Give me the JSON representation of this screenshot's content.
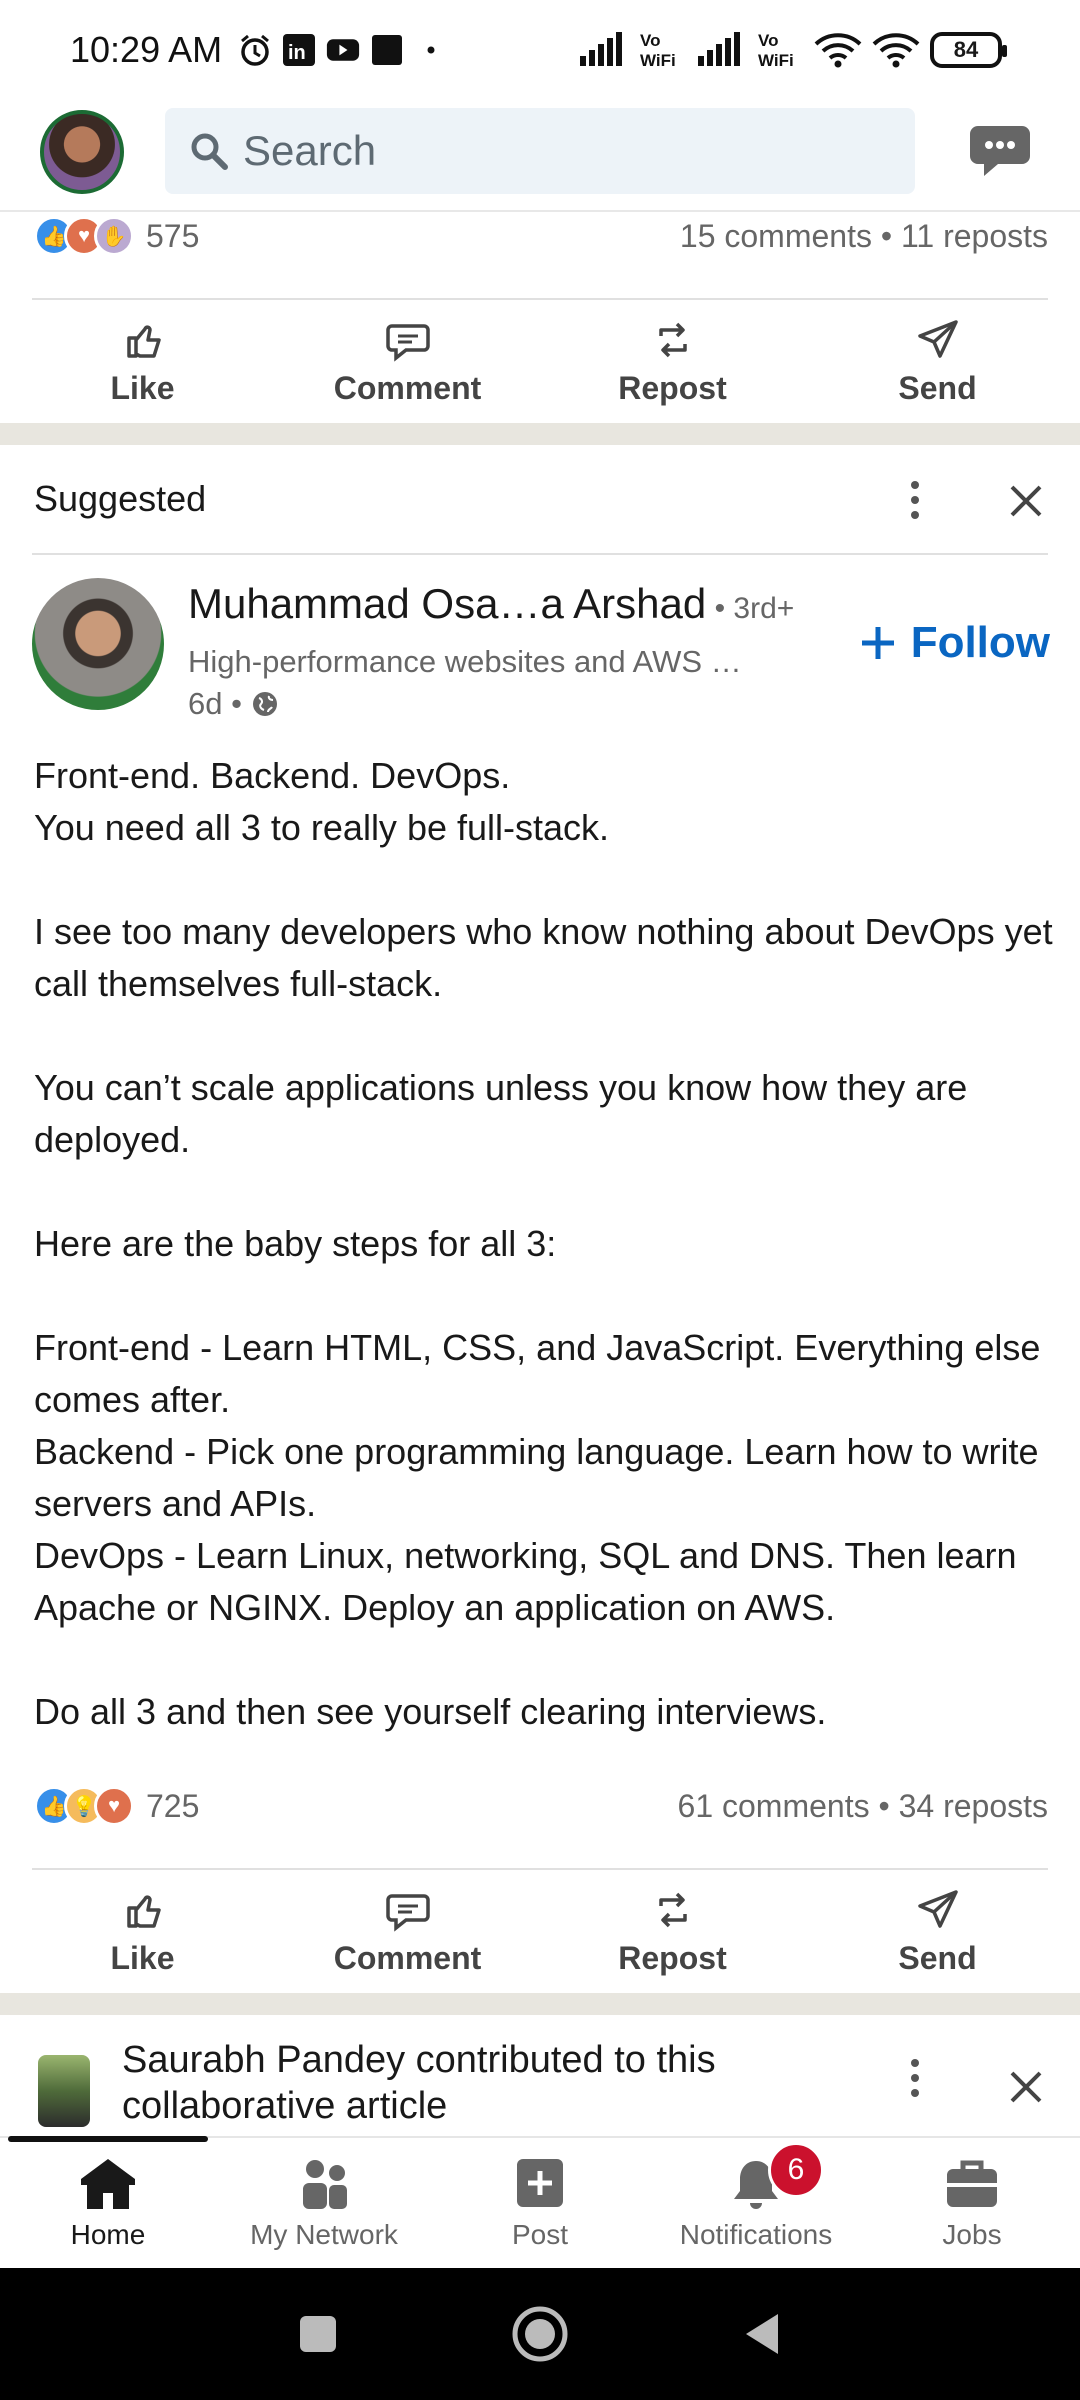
{
  "status_bar": {
    "time": "10:29 AM",
    "icons": [
      "alarm-icon",
      "linkedin-icon",
      "youtube-icon",
      "app-icon",
      "dot-icon"
    ],
    "network": [
      "signal-icon",
      "vowifi-icon",
      "signal-icon",
      "vowifi-icon",
      "wifi-icon",
      "wifi-icon"
    ],
    "battery": "84"
  },
  "top_bar": {
    "search_placeholder": "Search",
    "messaging_icon": "messaging-icon"
  },
  "previous_post": {
    "reaction_count": "575",
    "stats": "15 comments • 11 reposts",
    "reactions": [
      "like",
      "love",
      "support"
    ]
  },
  "actions": {
    "like": "Like",
    "comment": "Comment",
    "repost": "Repost",
    "send": "Send"
  },
  "suggested_post": {
    "section_label": "Suggested",
    "author": {
      "name": "Muhammad Osa…a Arshad",
      "degree": " • 3rd+",
      "headline": "High-performance websites and AWS …",
      "time": "6d •",
      "visibility_icon": "globe-icon"
    },
    "follow_label": "Follow",
    "body": [
      "Front-end. Backend. DevOps.\nYou need all 3 to really be full-stack.",
      "I see too many developers who know nothing about DevOps yet call themselves full-stack.",
      "You can’t scale applications unless you know how they are deployed.",
      "Here are the baby steps for all 3:",
      "Front-end - Learn HTML, CSS, and JavaScript. Everything else comes after.\nBackend - Pick one programming language. Learn how to write servers and APIs.\nDevOps - Learn Linux, networking, SQL and DNS. Then learn Apache or NGINX. Deploy an application on AWS.",
      "Do all 3 and then see yourself clearing interviews."
    ],
    "reaction_count": "725",
    "stats": "61 comments • 34 reposts",
    "reactions": [
      "like",
      "insightful",
      "love"
    ]
  },
  "collab_post": {
    "name": "Saurabh Pandey",
    "text": " contributed to this collaborative article"
  },
  "bottom_nav": [
    {
      "label": "Home",
      "icon": "home-icon",
      "active": true
    },
    {
      "label": "My Network",
      "icon": "network-icon",
      "active": false
    },
    {
      "label": "Post",
      "icon": "post-icon",
      "active": false
    },
    {
      "label": "Notifications",
      "icon": "bell-icon",
      "active": false,
      "badge": "6"
    },
    {
      "label": "Jobs",
      "icon": "briefcase-icon",
      "active": false
    }
  ],
  "system_nav": [
    "recents-button",
    "home-button",
    "back-button"
  ]
}
